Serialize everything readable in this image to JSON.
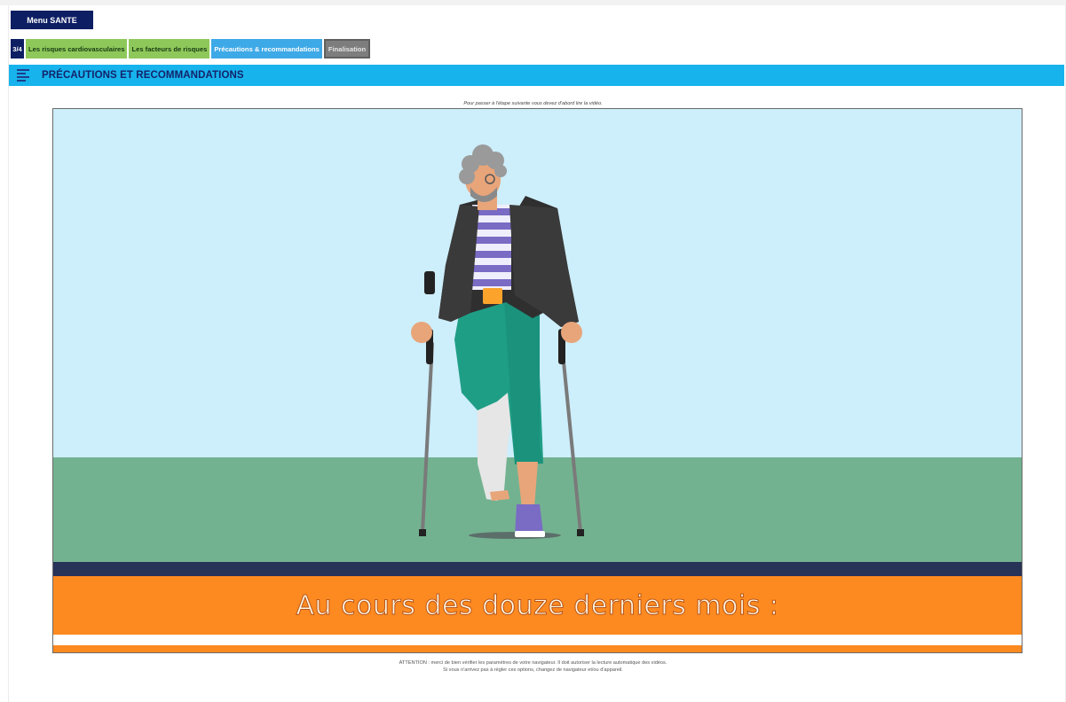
{
  "header": {
    "menu_label": "Menu SANTE"
  },
  "steps": {
    "counter": "3/4",
    "items": [
      {
        "label": "Les risques cardiovasculaires",
        "state": "done"
      },
      {
        "label": "Les facteurs de risques",
        "state": "done"
      },
      {
        "label": "Précautions & recommandations",
        "state": "active"
      },
      {
        "label": "Finalisation",
        "state": "todo"
      }
    ]
  },
  "section": {
    "title": "PRÉCAUTIONS ET RECOMMANDATIONS",
    "icon": "list-icon"
  },
  "video": {
    "notice": "Pour passer à l'étape suivante vous devez d'abord lire la vidéo.",
    "subtitle": "Au cours des douze derniers mois :"
  },
  "footer": {
    "attention_line1": "ATTENTION : merci de bien vérifier les paramètres de votre navigateur. Il doit autoriser la lecture automatique des vidéos.",
    "attention_line2": "Si vous n'arrivez pas à régler ces options, changez de navigateur et/ou d'appareil."
  },
  "colors": {
    "navy": "#0d1e63",
    "done_green": "#8fc85a",
    "active_blue": "#3ea9e7",
    "todo_grey": "#7d7d7d",
    "section_cyan": "#17b3ec",
    "video_orange": "#fd8a20"
  }
}
